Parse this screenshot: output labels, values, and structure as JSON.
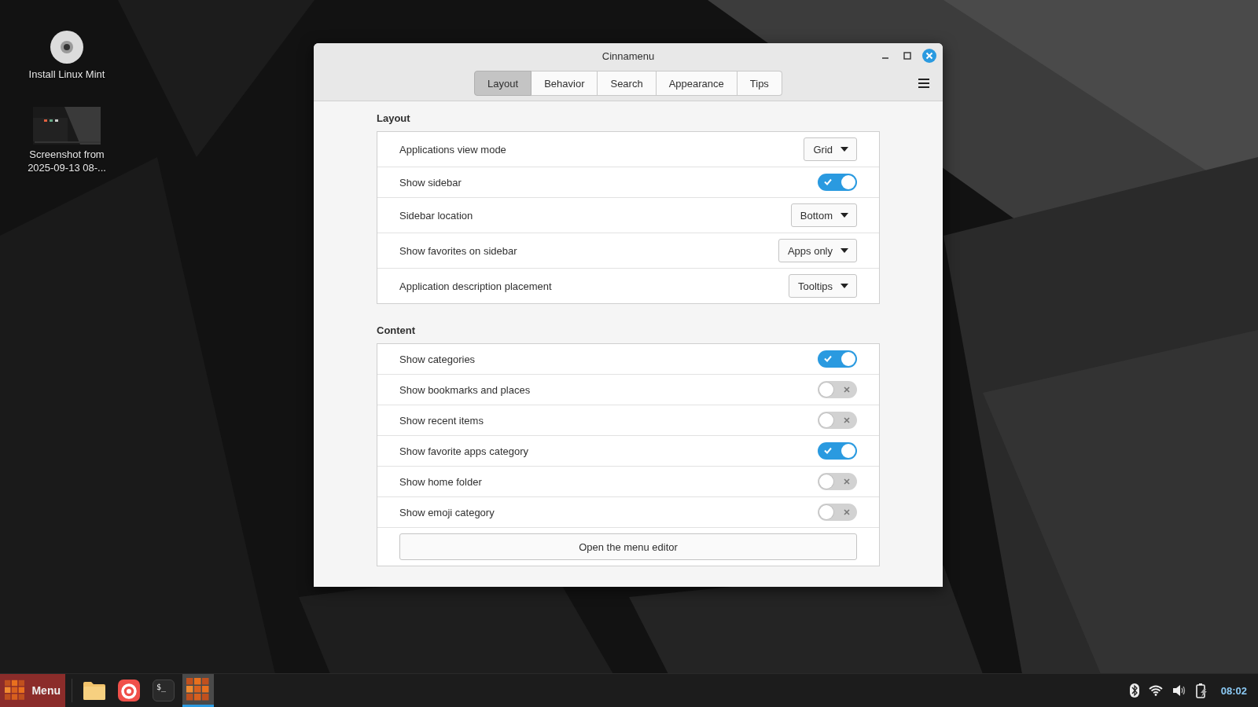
{
  "desktop_icons": [
    {
      "kind": "disc",
      "label": "Install Linux Mint"
    },
    {
      "kind": "screenshot",
      "label": "Screenshot from 2025-09-13 08-..."
    }
  ],
  "window": {
    "title": "Cinnamenu",
    "tabs": [
      {
        "label": "Layout",
        "selected": true
      },
      {
        "label": "Behavior",
        "selected": false
      },
      {
        "label": "Search",
        "selected": false
      },
      {
        "label": "Appearance",
        "selected": false
      },
      {
        "label": "Tips",
        "selected": false
      }
    ],
    "sections": [
      {
        "title": "Layout",
        "rows": [
          {
            "kind": "dropdown",
            "label": "Applications view mode",
            "value": "Grid"
          },
          {
            "kind": "switch",
            "label": "Show sidebar",
            "on": true
          },
          {
            "kind": "dropdown",
            "label": "Sidebar location",
            "value": "Bottom"
          },
          {
            "kind": "dropdown",
            "label": "Show favorites on sidebar",
            "value": "Apps only"
          },
          {
            "kind": "dropdown",
            "label": "Application description placement",
            "value": "Tooltips"
          }
        ]
      },
      {
        "title": "Content",
        "rows": [
          {
            "kind": "switch",
            "label": "Show categories",
            "on": true
          },
          {
            "kind": "switch",
            "label": "Show bookmarks and places",
            "on": false
          },
          {
            "kind": "switch",
            "label": "Show recent items",
            "on": false
          },
          {
            "kind": "switch",
            "label": "Show favorite apps category",
            "on": true
          },
          {
            "kind": "switch",
            "label": "Show home folder",
            "on": false
          },
          {
            "kind": "switch",
            "label": "Show emoji category",
            "on": false
          },
          {
            "kind": "button",
            "label": "Open the menu editor"
          }
        ]
      }
    ]
  },
  "taskbar": {
    "menu_label": "Menu",
    "launchers": [
      {
        "kind": "folder",
        "selected": false
      },
      {
        "kind": "browser",
        "selected": false
      },
      {
        "kind": "terminal",
        "glyph": "$_",
        "selected": false
      },
      {
        "kind": "menu",
        "selected": true
      }
    ],
    "clock": "08:02"
  }
}
